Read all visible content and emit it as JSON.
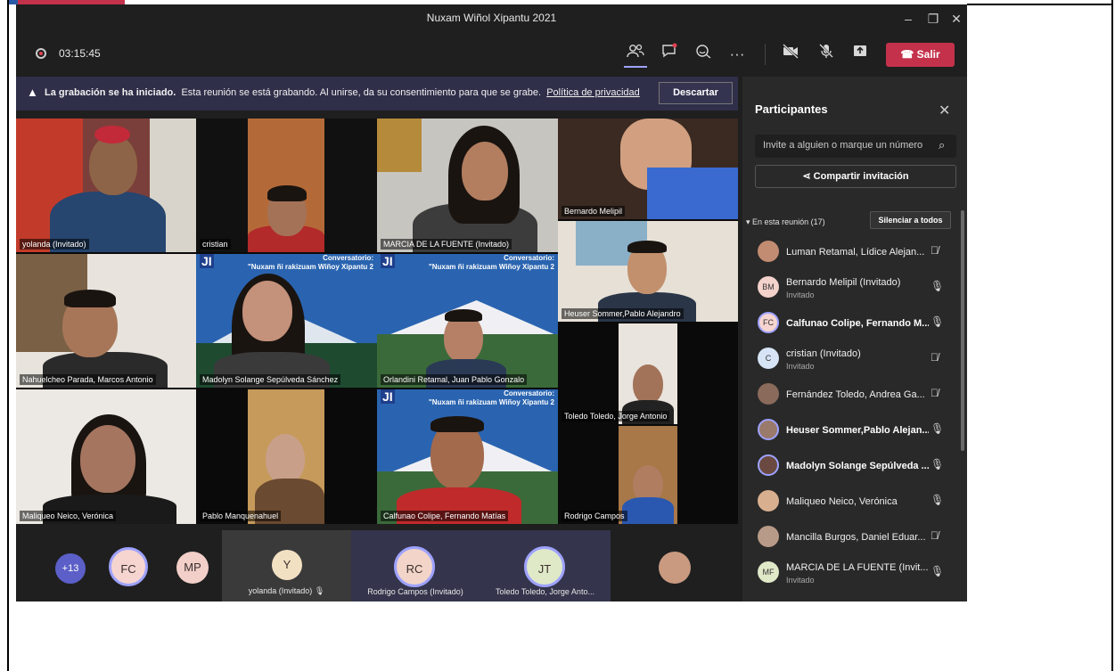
{
  "window": {
    "title": "Nuxam Wiñol Xipantu 2021",
    "minimize_icon": "minimize-icon",
    "maximize_icon": "maximize-icon",
    "close_icon": "close-icon"
  },
  "toolbar": {
    "recording_time": "03:15:45",
    "leave_label": "Salir",
    "icons": [
      "participants-icon",
      "chat-icon",
      "reactions-icon",
      "more-options-icon",
      "camera-off-icon",
      "mic-off-icon",
      "share-screen-icon",
      "phone-hangup-icon"
    ]
  },
  "banner": {
    "title": "La grabación se ha iniciado.",
    "message": "Esta reunión se está grabando. Al unirse, da su consentimiento para que se grabe.",
    "link": "Política de privacidad",
    "dismiss_label": "Descartar"
  },
  "tiles": [
    {
      "name": "yolanda (Invitado)"
    },
    {
      "name": "cristian"
    },
    {
      "name": "MARCIA DE LA FUENTE (Invitado)"
    },
    {
      "name": "Bernardo Melipil"
    },
    {
      "name": "Nahuelcheo Parada, Marcos Antonio"
    },
    {
      "name": "Madolyn Solange Sepúlveda Sánchez",
      "banner_1": "Conversatorio:",
      "banner_2": "\"Nuxam ñi rakizuam Wiñoy Xipantu 2"
    },
    {
      "name": "Orlandini Retamal, Juan Pablo Gonzalo",
      "banner_1": "Conversatorio:",
      "banner_2": "\"Nuxam ñi rakizuam Wiñoy Xipantu 2"
    },
    {
      "name": "Heuser Sommer,Pablo Alejandro"
    },
    {
      "name": "Toledo Toledo, Jorge Antonio"
    },
    {
      "name": "Maliqueo Neico, Verónica"
    },
    {
      "name": "Pablo Manquenahuel"
    },
    {
      "name": "Calfunao Colipe, Fernando Matías",
      "banner_1": "Conversatorio:",
      "banner_2": "\"Nuxam ñi rakizuam Wiñoy Xipantu 2"
    },
    {
      "name": "Rodrigo Campos"
    }
  ],
  "strip": {
    "more_count": "+13",
    "avatars": [
      {
        "initials": "FC"
      },
      {
        "initials": "MP"
      },
      {
        "initials": "Y",
        "label": "yolanda (Invitado)"
      },
      {
        "initials": "RC",
        "label": "Rodrigo Campos (Invitado)"
      },
      {
        "initials": "JT",
        "label": "Toledo Toledo, Jorge Anto..."
      }
    ]
  },
  "panel": {
    "title": "Participantes",
    "search_placeholder": "Invite a alguien o marque un número",
    "share_label": "Compartir invitación",
    "section_label": "En esta reunión (17)",
    "mute_all_label": "Silenciar a todos",
    "participants": [
      {
        "name": "Luman Retamal, Lídice Alejan...",
        "avatar": "photo",
        "mic": "muted"
      },
      {
        "name": "Bernardo Melipil (Invitado)",
        "sub": "Invitado",
        "initials": "BM",
        "mic": "on"
      },
      {
        "name": "Calfunao Colipe, Fernando M...",
        "initials": "FC",
        "mic": "on",
        "bold": true
      },
      {
        "name": "cristian (Invitado)",
        "sub": "Invitado",
        "initials": "C",
        "mic": "muted"
      },
      {
        "name": "Fernández Toledo, Andrea Ga...",
        "avatar": "photo",
        "mic": "muted"
      },
      {
        "name": "Heuser Sommer,Pablo Alejan...",
        "avatar": "photo",
        "mic": "on",
        "bold": true
      },
      {
        "name": "Madolyn Solange Sepúlveda ...",
        "avatar": "photo",
        "mic": "on",
        "bold": true
      },
      {
        "name": "Maliqueo Neico, Verónica",
        "avatar": "photo",
        "mic": "on"
      },
      {
        "name": "Mancilla Burgos, Daniel Eduar...",
        "avatar": "photo",
        "mic": "muted"
      },
      {
        "name": "MARCIA DE LA FUENTE (Invit...",
        "sub": "Invitado",
        "initials": "MF",
        "mic": "on"
      }
    ]
  }
}
